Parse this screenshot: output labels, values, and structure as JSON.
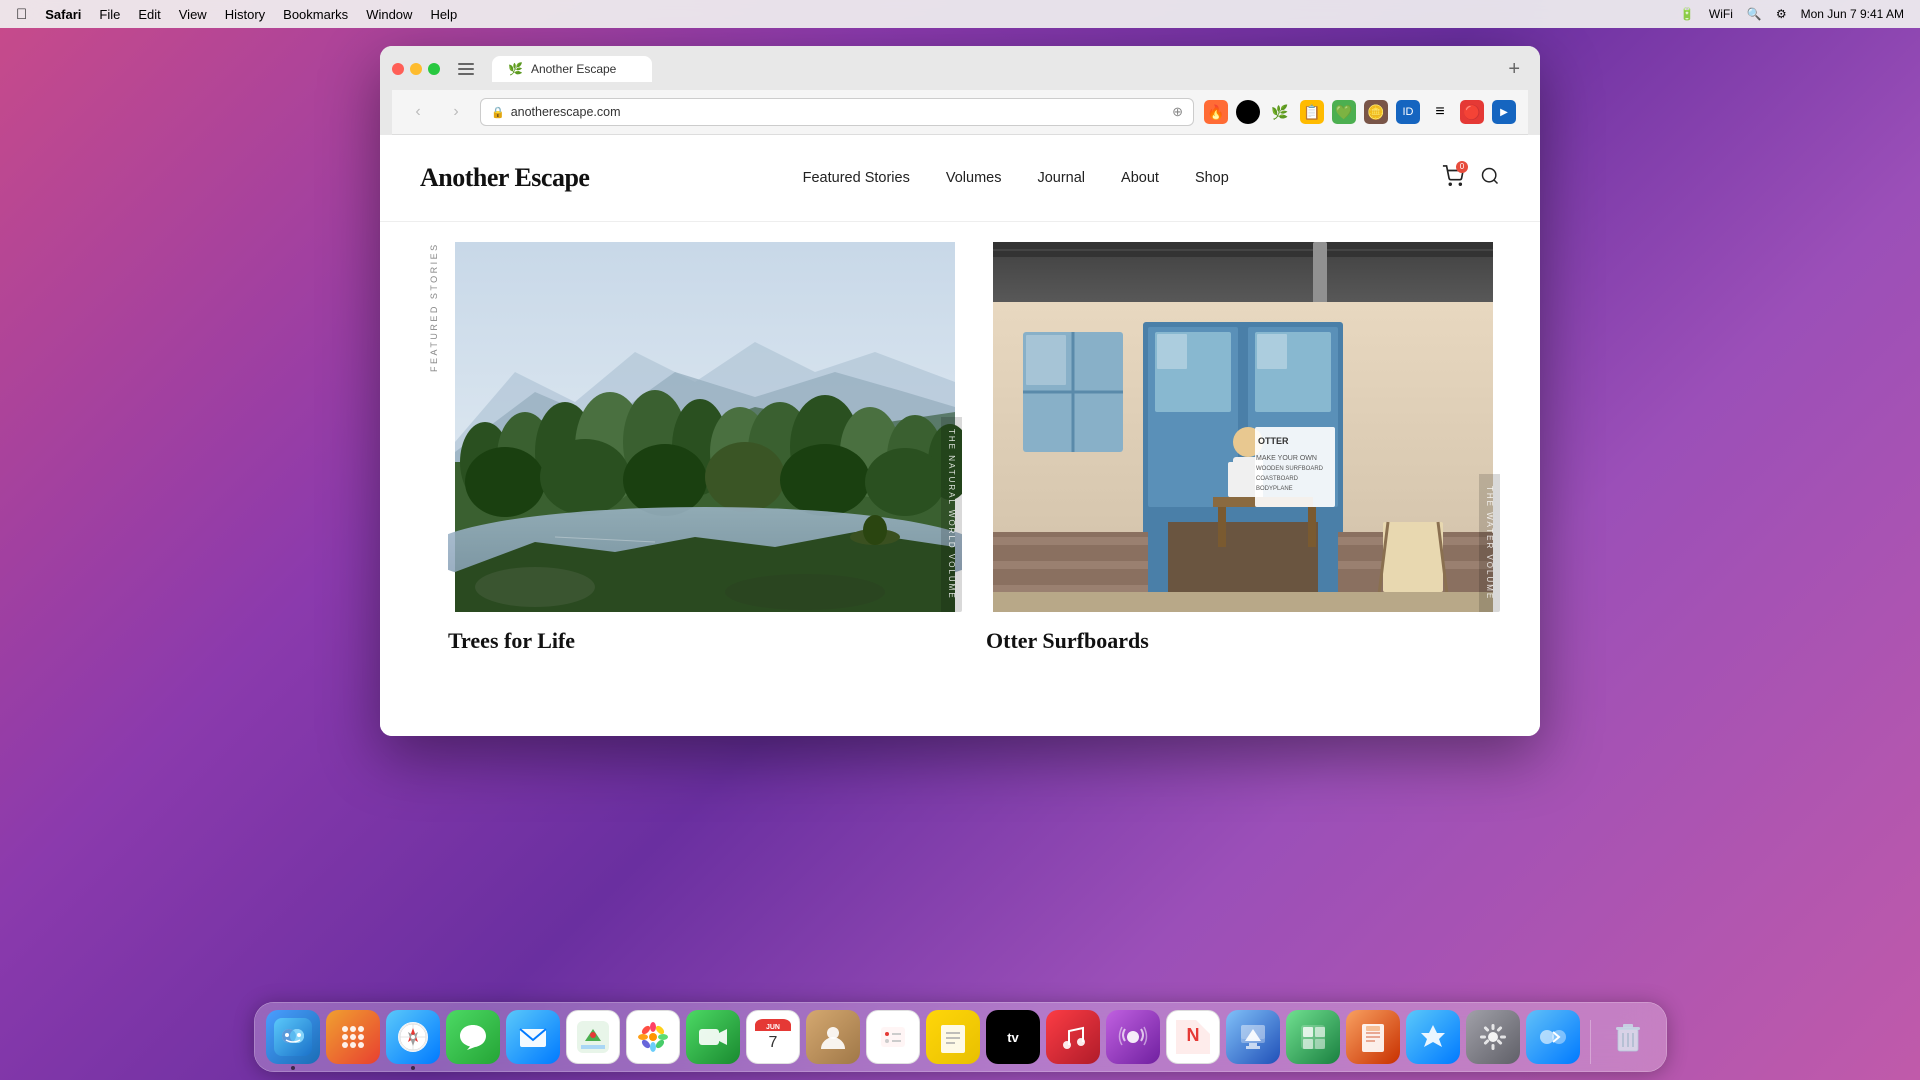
{
  "menubar": {
    "apple": "&#63743;",
    "app_name": "Safari",
    "menu_items": [
      "File",
      "Edit",
      "View",
      "History",
      "Bookmarks",
      "Window",
      "Help"
    ],
    "time": "Mon Jun 7  9:41 AM"
  },
  "browser": {
    "tab_title": "Another Escape",
    "url": "anotherescape.com",
    "back_button": "‹",
    "forward_button": "›"
  },
  "site": {
    "logo": "Another Escape",
    "nav": {
      "featured": "Featured Stories",
      "volumes": "Volumes",
      "journal": "Journal",
      "about": "About",
      "shop": "Shop"
    }
  },
  "section_label": "Featured Stories",
  "stories": [
    {
      "title": "Trees for Life",
      "side_label": "The Natural World Volume",
      "image_alt": "Scottish highland landscape with lake and forest"
    },
    {
      "title": "Otter Surfboards",
      "side_label": "The Water Volume",
      "image_alt": "Surfboard workshop with blue door"
    }
  ],
  "dock": {
    "apps": [
      {
        "name": "Finder",
        "label": "finder"
      },
      {
        "name": "Launchpad",
        "label": "launchpad"
      },
      {
        "name": "Safari",
        "label": "safari"
      },
      {
        "name": "Messages",
        "label": "messages"
      },
      {
        "name": "Mail",
        "label": "mail"
      },
      {
        "name": "Maps",
        "label": "maps"
      },
      {
        "name": "Photos",
        "label": "photos"
      },
      {
        "name": "FaceTime",
        "label": "facetime"
      },
      {
        "name": "Calendar",
        "label": "calendar"
      },
      {
        "name": "Contacts",
        "label": "contacts"
      },
      {
        "name": "Reminders",
        "label": "reminders"
      },
      {
        "name": "Notes",
        "label": "notes"
      },
      {
        "name": "Apple TV",
        "label": "tv"
      },
      {
        "name": "Music",
        "label": "music"
      },
      {
        "name": "Podcasts",
        "label": "podcasts"
      },
      {
        "name": "News",
        "label": "news"
      },
      {
        "name": "Keynote",
        "label": "keynote"
      },
      {
        "name": "Numbers",
        "label": "numbers"
      },
      {
        "name": "Pages",
        "label": "pages"
      },
      {
        "name": "App Store",
        "label": "appstore"
      },
      {
        "name": "System Preferences",
        "label": "prefs"
      },
      {
        "name": "Migration Assistant",
        "label": "migration"
      },
      {
        "name": "Trash",
        "label": "trash"
      }
    ]
  }
}
